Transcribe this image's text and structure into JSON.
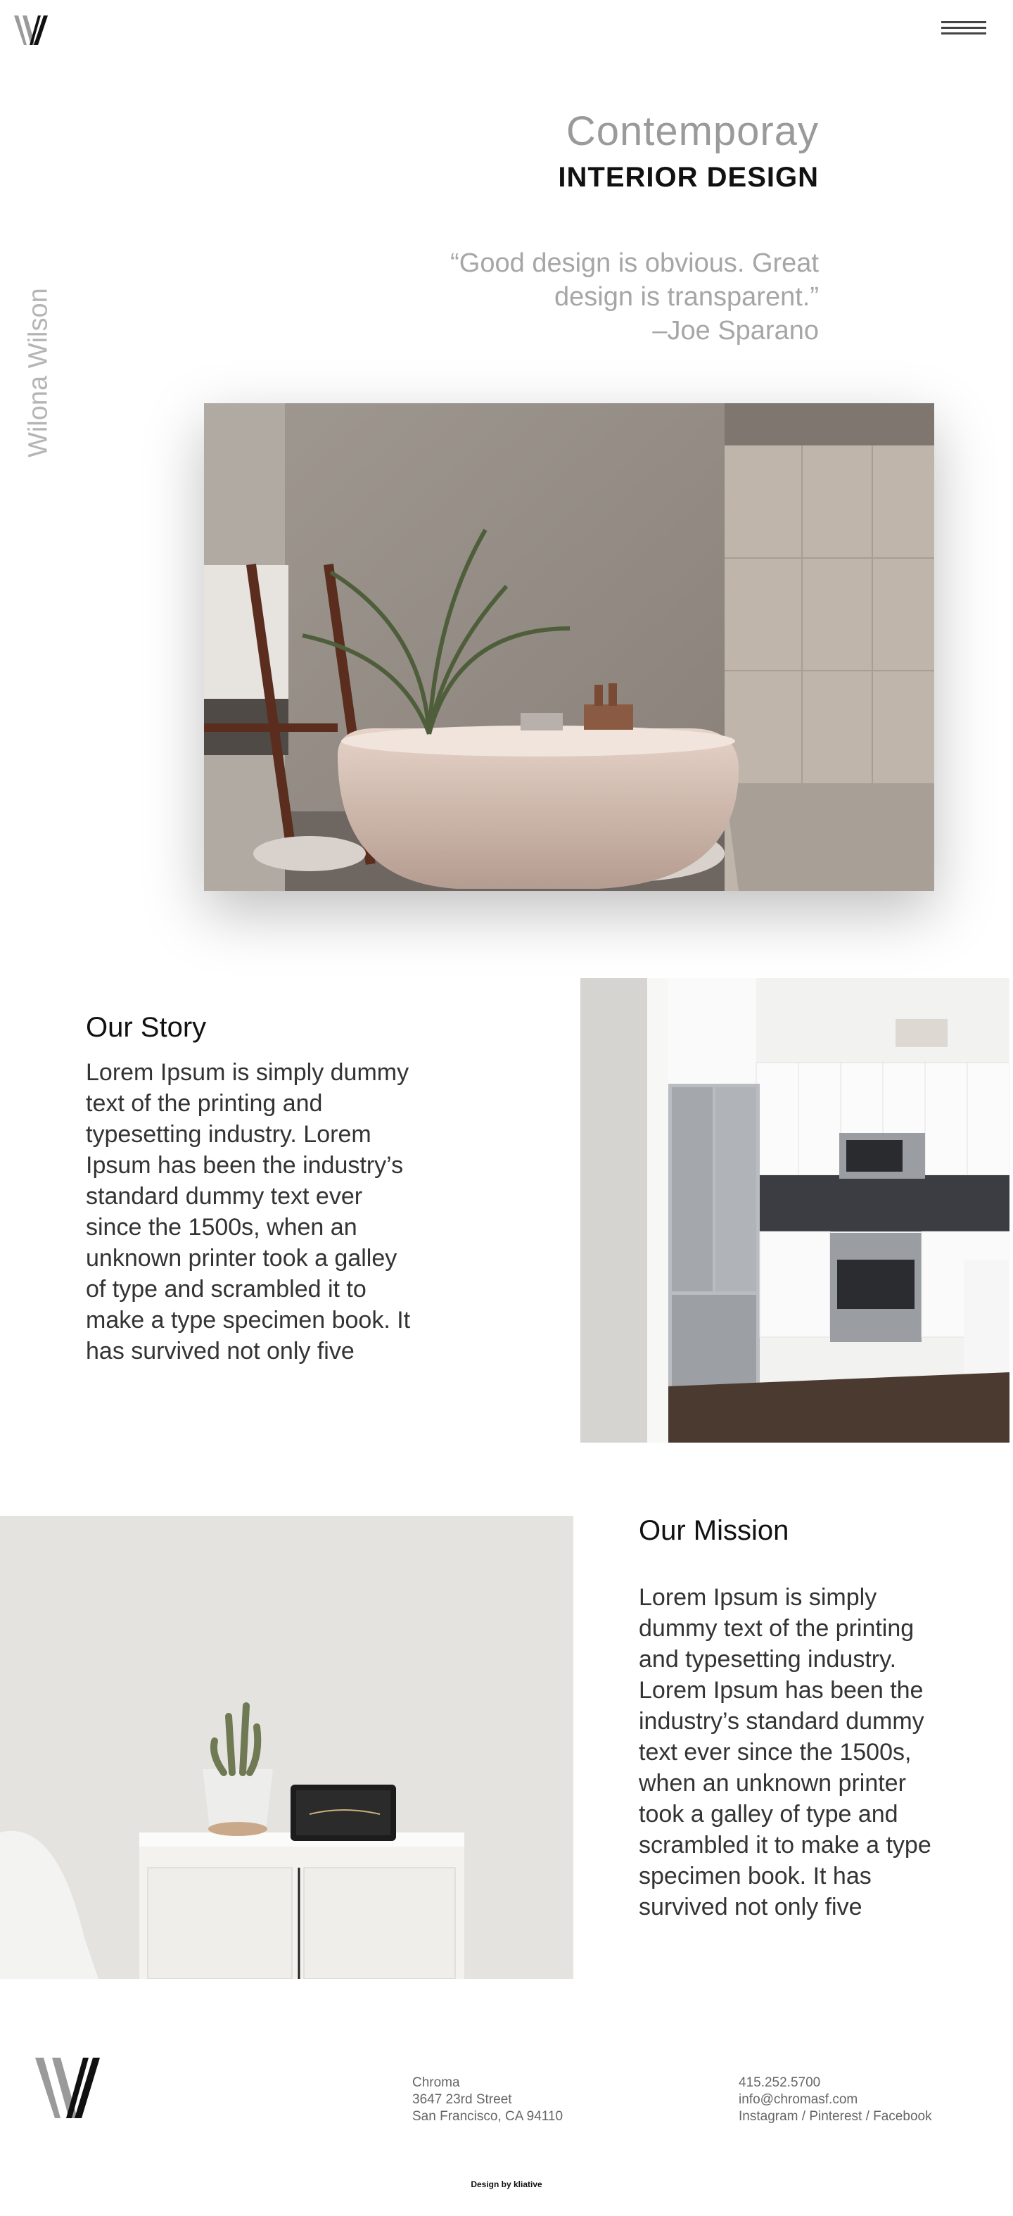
{
  "brand": {
    "logo_letter": "W",
    "colors": {
      "text": "#111111",
      "muted": "#a6a6a6",
      "background": "#ffffff"
    }
  },
  "header": {
    "menu_icon": "hamburger-menu-icon"
  },
  "hero": {
    "title": "Contemporay",
    "subtitle": "INTERIOR DESIGN",
    "quote_lines": [
      "“Good design is obvious. Great",
      "design is transparent.”",
      "–Joe Sparano"
    ],
    "vertical_name": "Wilona Wilson"
  },
  "story": {
    "heading": "Our Story",
    "body": "Lorem Ipsum is simply dummy text of the printing and typesetting industry. Lorem Ipsum has been the industry’s standard dummy text ever since the 1500s, when an unknown printer took a galley of type and scrambled it to make a type specimen book. It has survived not only five"
  },
  "mission": {
    "heading": "Our Mission",
    "body": "Lorem Ipsum is simply dummy text of the printing and typesetting industry. Lorem Ipsum has been the industry’s standard dummy text ever since the 1500s, when an unknown printer took a galley of type and scrambled it to make a type specimen book. It has survived not only five"
  },
  "footer": {
    "company": "Chroma",
    "street": "3647 23rd Street",
    "city": "San Francisco, CA 94110",
    "phone": "415.252.5700",
    "email": "info@chromasf.com",
    "social": "Instagram / Pinterest / Facebook",
    "credit": "Design by kliative"
  }
}
